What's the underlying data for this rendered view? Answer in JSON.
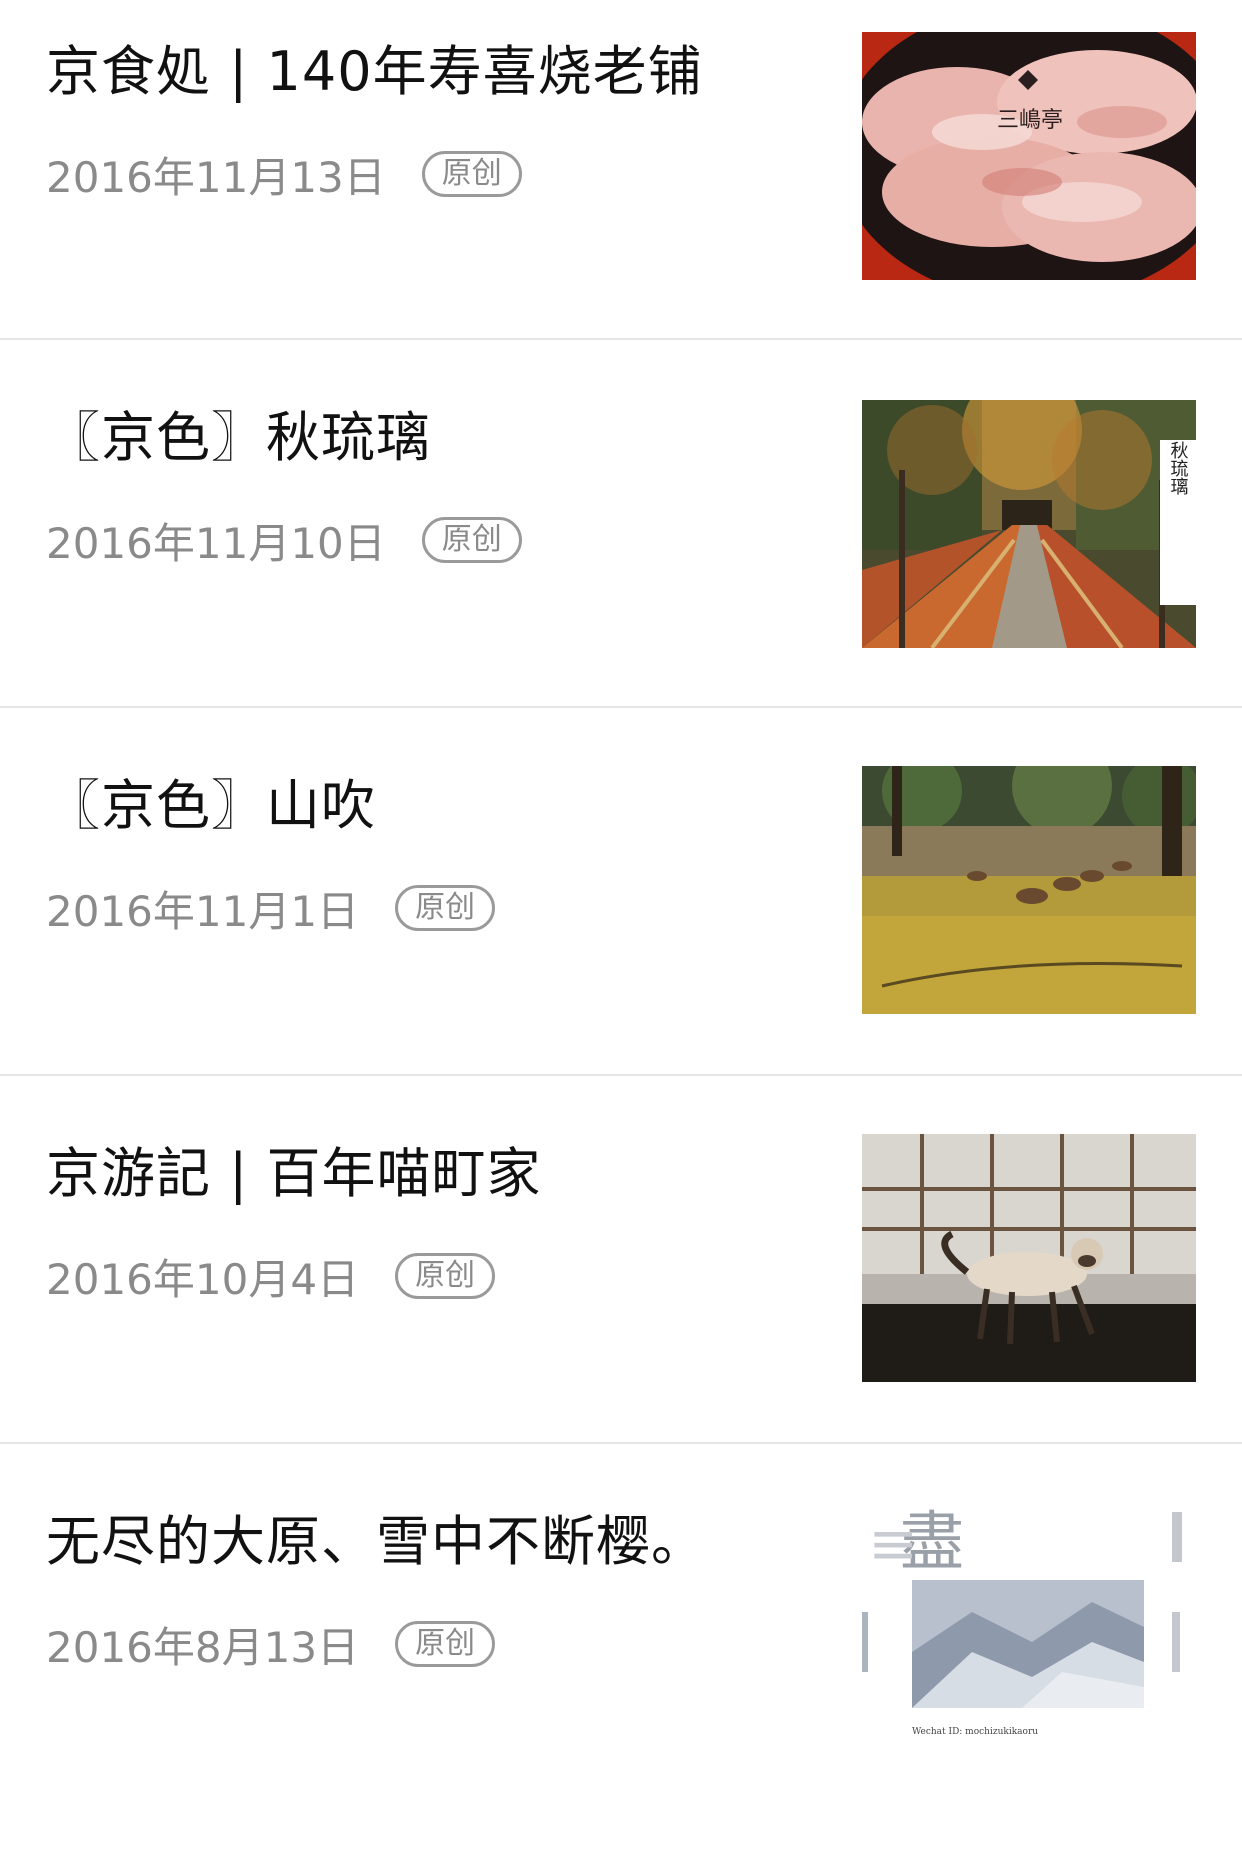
{
  "articles": [
    {
      "title": "京食処 | 140年寿喜烧老铺",
      "date": "2016年11月13日",
      "badge": "原创",
      "image": "wagyu-beef-thumbnail",
      "image_text": "三嶋亭"
    },
    {
      "title": "〖京色〗秋琉璃",
      "date": "2016年11月10日",
      "badge": "原创",
      "image": "autumn-temple-path-thumbnail",
      "image_text": "秋琉璃"
    },
    {
      "title": "〖京色〗山吹",
      "date": "2016年11月1日",
      "badge": "原创",
      "image": "deer-in-forest-thumbnail"
    },
    {
      "title": "京游記 | 百年喵町家",
      "date": "2016年10月4日",
      "badge": "原创",
      "image": "siamese-cat-thumbnail"
    },
    {
      "title": "无尽的大原、雪中不断樱。",
      "date": "2016年8月13日",
      "badge": "原创",
      "image": "snowy-mountains-thumbnail",
      "image_text": "盡",
      "image_caption": "Wechat ID: mochizukikaoru"
    }
  ],
  "colors": {
    "title": "#111111",
    "date": "#8a8a8a",
    "divider": "#e6e6e6"
  }
}
